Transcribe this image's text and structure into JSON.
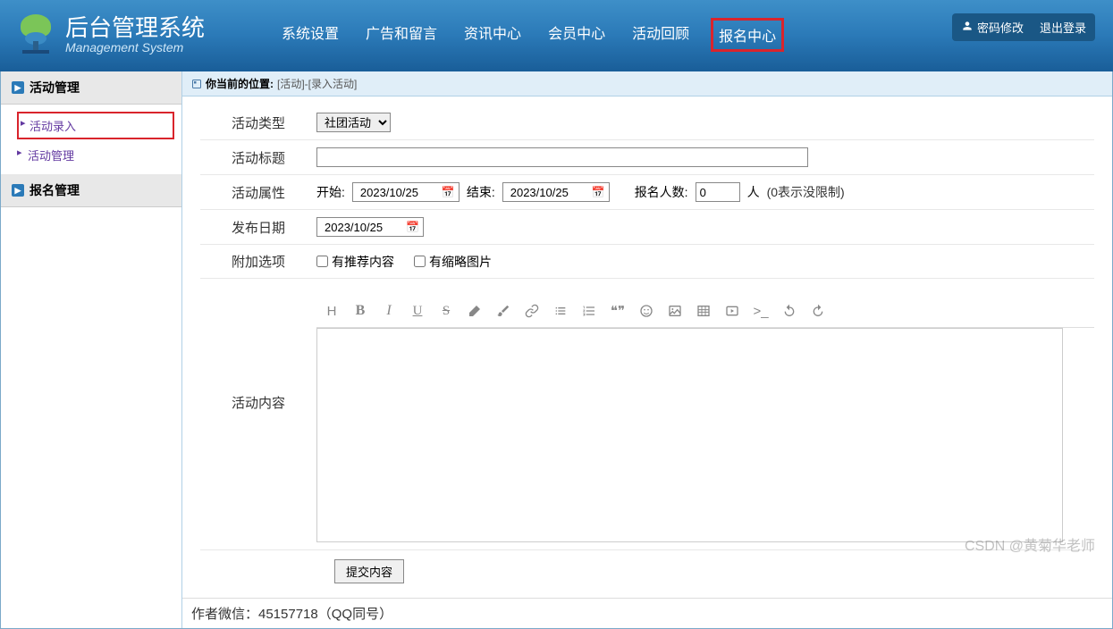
{
  "header": {
    "title": "后台管理系统",
    "subtitle": "Management System"
  },
  "nav": {
    "items": [
      "系统设置",
      "广告和留言",
      "资讯中心",
      "会员中心",
      "活动回顾",
      "报名中心"
    ],
    "highlighted_index": 5
  },
  "user": {
    "pwd_label": "密码修改",
    "logout_label": "退出登录"
  },
  "sidebar": {
    "sections": [
      {
        "title": "活动管理",
        "items": [
          {
            "label": "活动录入",
            "highlighted": true
          },
          {
            "label": "活动管理",
            "highlighted": false
          }
        ]
      },
      {
        "title": "报名管理",
        "items": []
      }
    ]
  },
  "breadcrumb": {
    "label": "你当前的位置:",
    "path": "[活动]-[录入活动]"
  },
  "form": {
    "type_label": "活动类型",
    "type_value": "社团活动",
    "title_label": "活动标题",
    "title_value": "",
    "attr_label": "活动属性",
    "start_label": "开始:",
    "start_value": "2023/10/25",
    "end_label": "结束:",
    "end_value": "2023/10/25",
    "signup_label": "报名人数:",
    "signup_value": "0",
    "signup_unit": "人",
    "signup_hint": "(0表示没限制)",
    "publish_label": "发布日期",
    "publish_value": "2023/10/25",
    "extra_label": "附加选项",
    "cb1_label": "有推荐内容",
    "cb2_label": "有缩略图片",
    "content_label": "活动内容",
    "submit_label": "提交内容"
  },
  "footer": {
    "text": "作者微信：45157718（QQ同号）"
  },
  "watermark": "CSDN @黄菊华老师"
}
